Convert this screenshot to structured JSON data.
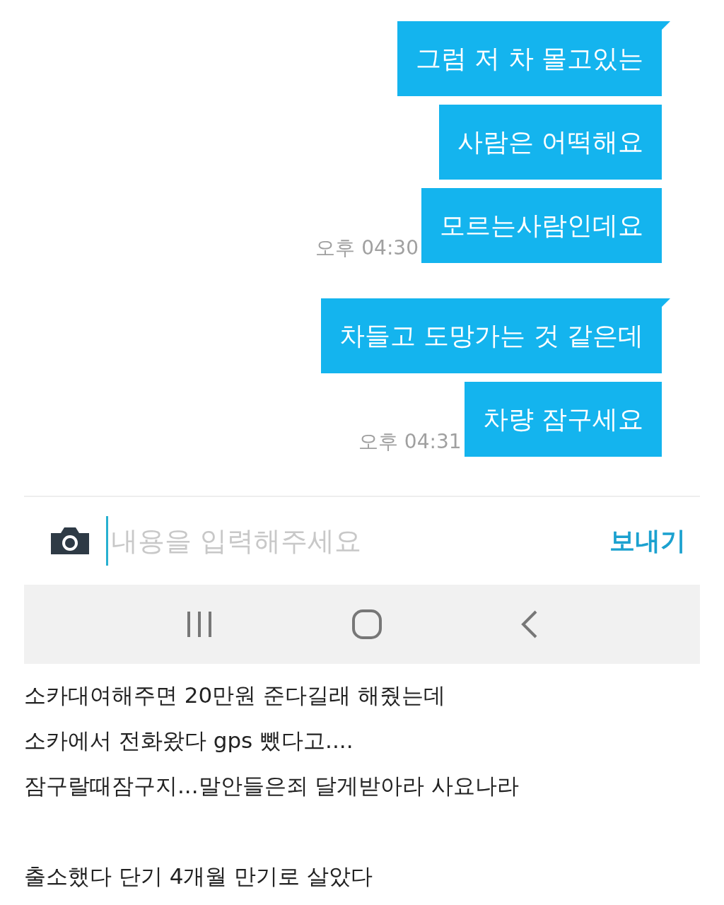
{
  "chat": {
    "groups": [
      {
        "messages": [
          "그럼 저 차 몰고있는",
          "사람은 어떡해요",
          "모르는사람인데요"
        ],
        "time": "오후 04:30"
      },
      {
        "messages": [
          "차들고 도망가는 것 같은데",
          "차량 잠구세요"
        ],
        "time": "오후 04:31"
      }
    ]
  },
  "composer": {
    "placeholder": "내용을 입력해주세요",
    "send": "보내기"
  },
  "caption": {
    "paragraphs": [
      {
        "lines": [
          "소카대여해주면 20만원 준다길래 해줬는데",
          "소카에서 전화왔다 gps 뺐다고....",
          "잠구랄때잠구지...말안들은죄 달게받아라 사요나라"
        ]
      },
      {
        "lines": [
          "출소했다 단기 4개월 만기로 살았다"
        ]
      }
    ]
  }
}
